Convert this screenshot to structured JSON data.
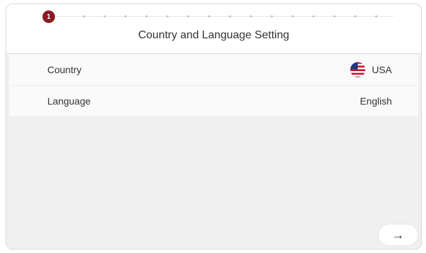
{
  "stepper": {
    "current_step": "1"
  },
  "header": {
    "title": "Country and Language Setting"
  },
  "settings": [
    {
      "label": "Country",
      "value": "USA",
      "icon": "us-flag-icon"
    },
    {
      "label": "Language",
      "value": "English"
    }
  ],
  "footer": {
    "next_icon": "→"
  },
  "colors": {
    "accent": "#8b1a24",
    "background": "#f0f0f0",
    "row_background": "#fafafa"
  }
}
